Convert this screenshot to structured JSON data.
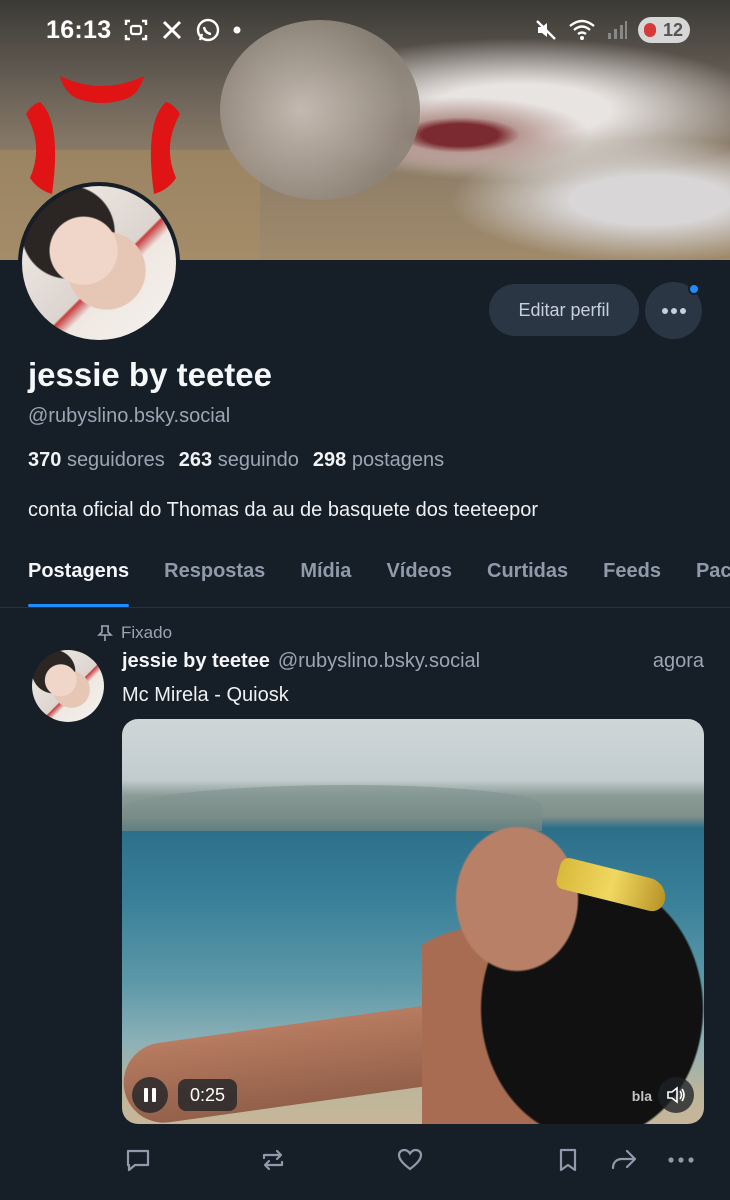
{
  "status_bar": {
    "time": "16:13",
    "battery": "12",
    "wifi_badge": "5"
  },
  "profile": {
    "display_name": "jessie by teetee",
    "handle": "@rubyslino.bsky.social",
    "followers_count": "370",
    "followers_label": "seguidores",
    "following_count": "263",
    "following_label": "seguindo",
    "posts_count": "298",
    "posts_label": "postagens",
    "bio": "conta oficial do Thomas da au de basquete dos teeteepor",
    "edit_button_label": "Editar perfil"
  },
  "tabs": [
    {
      "label": "Postagens",
      "active": true
    },
    {
      "label": "Respostas"
    },
    {
      "label": "Mídia"
    },
    {
      "label": "Vídeos"
    },
    {
      "label": "Curtidas"
    },
    {
      "label": "Feeds"
    },
    {
      "label": "Pacotes iniciais"
    }
  ],
  "post": {
    "pinned_label": "Fixado",
    "author_name": "jessie by teetee",
    "author_handle": "@rubyslino.bsky.social",
    "time": "agora",
    "text": "Mc Mirela - Quiosk",
    "video": {
      "duration": "0:25",
      "watermark": "bla"
    }
  },
  "colors": {
    "background": "#161e27",
    "accent": "#1f8cff",
    "muted_text": "#9aa6b4",
    "button_bg": "#2a3644"
  },
  "icons": {
    "reply": "speech-bubble-icon",
    "repost": "repost-arrows-icon",
    "like": "heart-icon",
    "bookmark": "bookmark-icon",
    "share": "share-arrow-icon",
    "more": "ellipsis-icon",
    "pinned": "pin-icon",
    "pause": "pause-icon",
    "volume": "speaker-icon"
  }
}
